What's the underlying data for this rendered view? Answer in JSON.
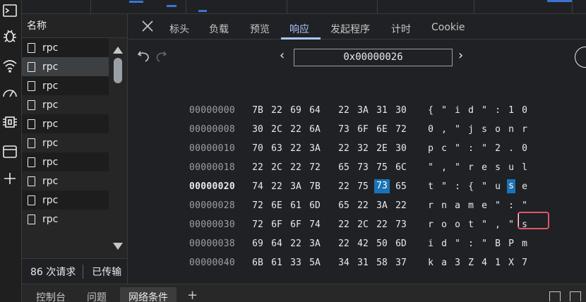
{
  "activity_icons": [
    "console-icon",
    "bug-icon",
    "wifi-icon",
    "performance-icon",
    "chip-icon",
    "window-icon",
    "plus-icon"
  ],
  "request_list": {
    "header": "名称",
    "items": [
      "rpc",
      "rpc",
      "rpc",
      "rpc",
      "rpc",
      "rpc",
      "rpc",
      "rpc",
      "rpc",
      "rpc"
    ],
    "selected_index": 1
  },
  "status": {
    "requests": "86 次请求",
    "transferred": "已传输"
  },
  "drawer": {
    "tabs": [
      "控制台",
      "问题",
      "网络条件"
    ],
    "add": "+"
  },
  "detail": {
    "tabs": [
      "标头",
      "负载",
      "预览",
      "响应",
      "发起程序",
      "计时",
      "Cookie"
    ],
    "active_tab": "响应",
    "address": "0x00000026",
    "prev": "‹",
    "next": "›"
  },
  "hex": {
    "rows": [
      {
        "offset": "00000000",
        "bytes": [
          "7B",
          "22",
          "69",
          "64",
          "22",
          "3A",
          "31",
          "30"
        ],
        "chars": [
          "{",
          "\"",
          "i",
          "d",
          "\"",
          ":",
          "1",
          "0"
        ]
      },
      {
        "offset": "00000008",
        "bytes": [
          "30",
          "2C",
          "22",
          "6A",
          "73",
          "6F",
          "6E",
          "72"
        ],
        "chars": [
          "0",
          ",",
          "\"",
          "j",
          "s",
          "o",
          "n",
          "r"
        ]
      },
      {
        "offset": "00000010",
        "bytes": [
          "70",
          "63",
          "22",
          "3A",
          "22",
          "32",
          "2E",
          "30"
        ],
        "chars": [
          "p",
          "c",
          "\"",
          ":",
          "\"",
          "2",
          ".",
          "0"
        ]
      },
      {
        "offset": "00000018",
        "bytes": [
          "22",
          "2C",
          "22",
          "72",
          "65",
          "73",
          "75",
          "6C"
        ],
        "chars": [
          "\"",
          ",",
          "\"",
          "r",
          "e",
          "s",
          "u",
          "l"
        ]
      },
      {
        "offset": "00000020",
        "bytes": [
          "74",
          "22",
          "3A",
          "7B",
          "22",
          "75",
          "73",
          "65"
        ],
        "chars": [
          "t",
          "\"",
          ":",
          "{",
          "\"",
          "u",
          "s",
          "e"
        ]
      },
      {
        "offset": "00000028",
        "bytes": [
          "72",
          "6E",
          "61",
          "6D",
          "65",
          "22",
          "3A",
          "22"
        ],
        "chars": [
          "r",
          "n",
          "a",
          "m",
          "e",
          "\"",
          ":",
          "\""
        ]
      },
      {
        "offset": "00000030",
        "bytes": [
          "72",
          "6F",
          "6F",
          "74",
          "22",
          "2C",
          "22",
          "73"
        ],
        "chars": [
          "r",
          "o",
          "o",
          "t",
          "\"",
          ",",
          "\"",
          "s"
        ]
      },
      {
        "offset": "00000038",
        "bytes": [
          "69",
          "64",
          "22",
          "3A",
          "22",
          "42",
          "50",
          "6D"
        ],
        "chars": [
          "i",
          "d",
          "\"",
          ":",
          "\"",
          "B",
          "P",
          "m"
        ]
      },
      {
        "offset": "00000040",
        "bytes": [
          "6B",
          "61",
          "33",
          "5A",
          "34",
          "31",
          "58",
          "37"
        ],
        "chars": [
          "k",
          "a",
          "3",
          "Z",
          "4",
          "1",
          "X",
          "7"
        ]
      }
    ],
    "current_row": 4,
    "highlight_byte": 6
  },
  "colors": {
    "highlight": "#1a73b8",
    "accent": "#a8c7fa",
    "annotation": "#e0576a"
  }
}
